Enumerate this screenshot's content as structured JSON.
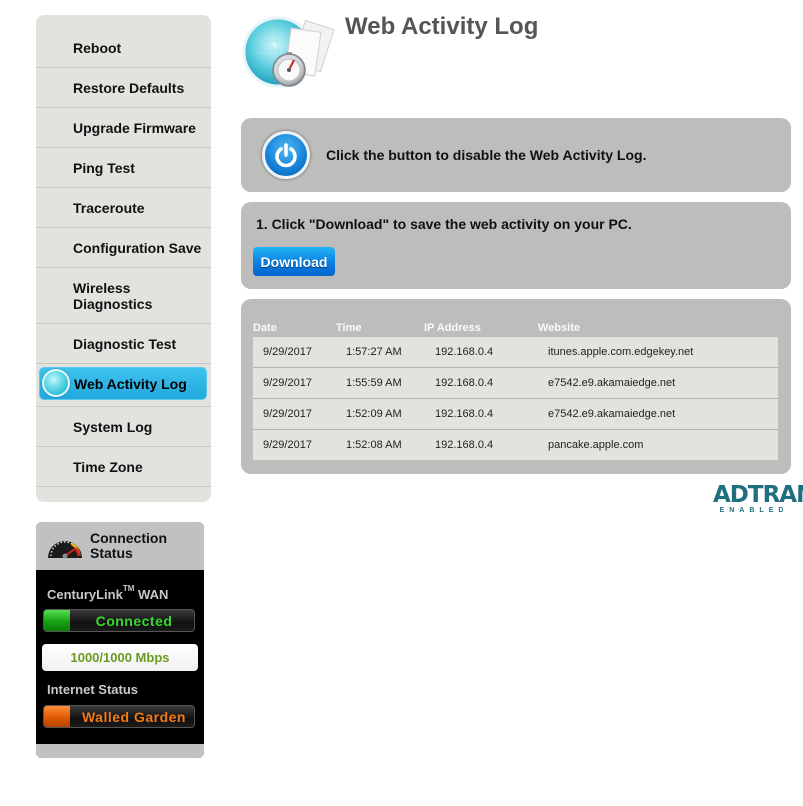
{
  "sidebar": {
    "items": [
      {
        "label": "Reboot"
      },
      {
        "label": "Restore Defaults"
      },
      {
        "label": "Upgrade Firmware"
      },
      {
        "label": "Ping Test"
      },
      {
        "label": "Traceroute"
      },
      {
        "label": "Configuration Save"
      },
      {
        "label": "Wireless Diagnostics"
      },
      {
        "label": "Diagnostic Test"
      },
      {
        "label": "Web Activity Log",
        "active": true
      },
      {
        "label": "System Log"
      },
      {
        "label": "Time Zone"
      }
    ]
  },
  "connection_status": {
    "title_line1": "Connection",
    "title_line2": "Status",
    "wan_label": "CenturyLink",
    "wan_tm": "TM",
    "wan_suffix": "WAN",
    "wan_status": "Connected",
    "speed": "1000/1000 Mbps",
    "internet_label": "Internet Status",
    "internet_status": "Walled Garden",
    "colors": {
      "connected": "#38d833",
      "walled_garden": "#f27a16",
      "speed": "#6a9a1f"
    }
  },
  "header": {
    "title": "Web Activity Log",
    "icon": "web-activity-stopwatch-icon"
  },
  "toggle_panel": {
    "icon": "power-icon",
    "text": "Click the button to disable the Web Activity Log."
  },
  "download_panel": {
    "instruction": "1. Click \"Download\" to save the web activity on your PC.",
    "button_label": "Download"
  },
  "log_table": {
    "columns": [
      "Date",
      "Time",
      "IP Address",
      "Website"
    ],
    "rows": [
      [
        "9/29/2017",
        "1:57:27 AM",
        "192.168.0.4",
        "itunes.apple.com.edgekey.net"
      ],
      [
        "9/29/2017",
        "1:55:59 AM",
        "192.168.0.4",
        "e7542.e9.akamaiedge.net"
      ],
      [
        "9/29/2017",
        "1:52:09 AM",
        "192.168.0.4",
        "e7542.e9.akamaiedge.net"
      ],
      [
        "9/29/2017",
        "1:52:08 AM",
        "192.168.0.4",
        "pancake.apple.com"
      ]
    ]
  },
  "logo": {
    "main": "ADTRAN",
    "sub": "ENABLED",
    "color": "#1f6f7f"
  }
}
